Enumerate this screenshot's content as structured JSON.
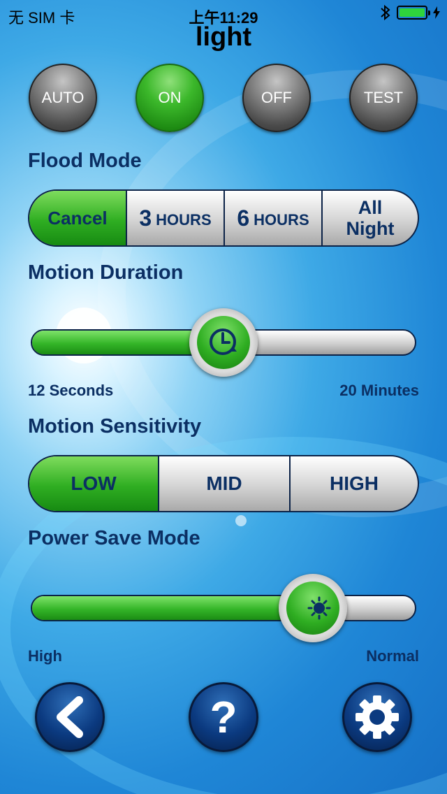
{
  "status_bar": {
    "carrier": "无 SIM 卡",
    "time": "上午11:29",
    "bluetooth_icon": "bluetooth-icon",
    "battery_icon": "battery-charging-icon"
  },
  "title": "light",
  "mode_buttons": [
    {
      "label": "AUTO",
      "active": false
    },
    {
      "label": "ON",
      "active": true
    },
    {
      "label": "OFF",
      "active": false
    },
    {
      "label": "TEST",
      "active": false
    }
  ],
  "flood_mode": {
    "label": "Flood Mode",
    "options": [
      {
        "label": "Cancel",
        "active": true
      },
      {
        "number": "3",
        "unit": "HOURS",
        "active": false
      },
      {
        "number": "6",
        "unit": "HOURS",
        "active": false
      },
      {
        "line1": "All",
        "line2": "Night",
        "active": false
      }
    ]
  },
  "motion_duration": {
    "label": "Motion Duration",
    "min_label": "12 Seconds",
    "max_label": "20 Minutes",
    "value_fraction": 0.5,
    "knob_icon": "clock-icon"
  },
  "motion_sensitivity": {
    "label": "Motion Sensitivity",
    "options": [
      {
        "label": "LOW",
        "active": true
      },
      {
        "label": "MID",
        "active": false
      },
      {
        "label": "HIGH",
        "active": false
      }
    ]
  },
  "power_save": {
    "label": "Power Save Mode",
    "min_label": "High",
    "max_label": "Normal",
    "value_fraction": 0.76,
    "knob_icon": "moon-sun-icon"
  },
  "bottom_nav": {
    "back_icon": "chevron-left-icon",
    "help_label": "?",
    "settings_icon": "gear-icon"
  },
  "colors": {
    "accent_green": "#2fae22",
    "label_navy": "#0b2f63",
    "nav_blue": "#0b3a80"
  }
}
